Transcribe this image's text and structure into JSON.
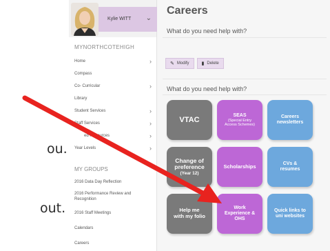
{
  "slide": {
    "frag1": "ou.",
    "frag2": "out."
  },
  "sidebar": {
    "user_name": "Kylie WITT",
    "school": "MYNORTHCOTEHIGH",
    "nav": [
      {
        "label": "Home",
        "arrow": true
      },
      {
        "label": "Compass",
        "arrow": false
      },
      {
        "label": "Co- Curricular",
        "arrow": true
      },
      {
        "label": "Library",
        "arrow": false
      },
      {
        "label": "Student Services",
        "arrow": true
      },
      {
        "label": "Staff Services",
        "arrow": true
      },
      {
        "label": "ed Resources",
        "arrow": true
      },
      {
        "label": "Year Levels",
        "arrow": true
      }
    ],
    "groups_title": "MY GROUPS",
    "groups": [
      "2016 Data Day Reflection",
      "2016 Performance Review and Recognition",
      "2016 Staff Meetings",
      "Calendars",
      "Careers"
    ]
  },
  "main": {
    "title": "Careers",
    "question1": "What do you need help with?",
    "modify": "Modify",
    "delete": "Delete",
    "question2": "What do you need help with?",
    "tiles": [
      {
        "label": "VTAC",
        "sub": "",
        "color": "#7a7a7a"
      },
      {
        "label": "SEAS",
        "sub": "(Special Entry Access Schemes)",
        "color": "#bd67d6"
      },
      {
        "label": "Careers newsletters",
        "sub": "",
        "color": "#6da8dd"
      },
      {
        "label": "Change of preference",
        "sub": "(Year 12)",
        "color": "#7a7a7a"
      },
      {
        "label": "Scholarships",
        "sub": "",
        "color": "#bd67d6"
      },
      {
        "label": "CVs & resumes",
        "sub": "",
        "color": "#6da8dd"
      },
      {
        "label": "Help me with my folio",
        "sub": "",
        "color": "#7a7a7a"
      },
      {
        "label": "Work Experience & OHS",
        "sub": "",
        "color": "#bd67d6"
      },
      {
        "label": "Quick links to uni websites",
        "sub": "",
        "color": "#6da8dd"
      }
    ]
  },
  "colors": {
    "accent_purple": "#dcc7e3",
    "arrow_red": "#e8231f"
  }
}
